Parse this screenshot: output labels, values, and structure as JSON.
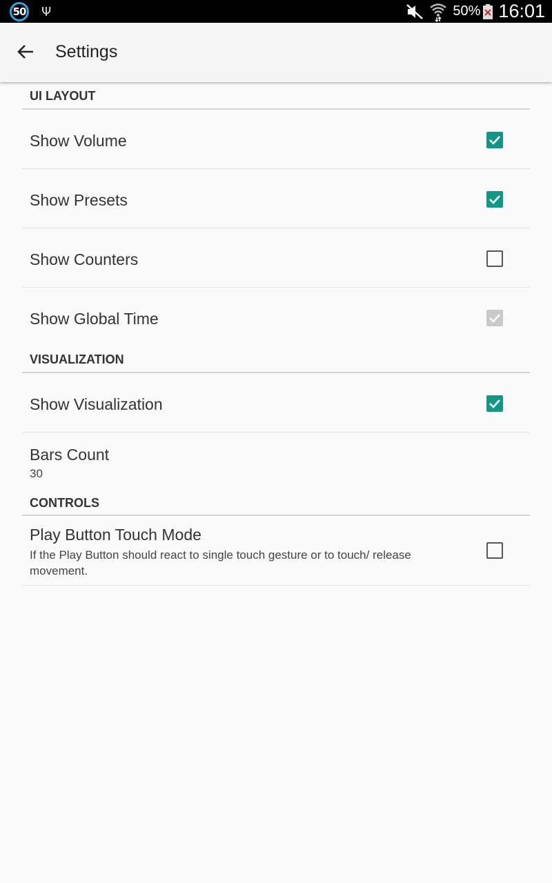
{
  "status_bar": {
    "notification_badge": "50",
    "usb_icon": "usb-icon",
    "battery_percent": "50%",
    "time": "16:01"
  },
  "app_bar": {
    "title": "Settings",
    "back_icon": "arrow-back-icon"
  },
  "colors": {
    "accent": "#129688",
    "disabled": "#c9c9c9"
  },
  "categories": [
    {
      "title": "UI LAYOUT",
      "items": [
        {
          "title": "Show Volume",
          "checked": true,
          "enabled": true
        },
        {
          "title": "Show Presets",
          "checked": true,
          "enabled": true
        },
        {
          "title": "Show Counters",
          "checked": false,
          "enabled": true
        },
        {
          "title": "Show Global Time",
          "checked": true,
          "enabled": false
        }
      ]
    },
    {
      "title": "VISUALIZATION",
      "items": [
        {
          "title": "Show Visualization",
          "checked": true,
          "enabled": true
        },
        {
          "title": "Bars Count",
          "summary": "30"
        }
      ]
    },
    {
      "title": "CONTROLS",
      "items": [
        {
          "title": "Play Button Touch Mode",
          "summary": "If the Play Button should react to single touch gesture or to touch/ release movement.",
          "checked": false,
          "enabled": true
        }
      ]
    }
  ]
}
